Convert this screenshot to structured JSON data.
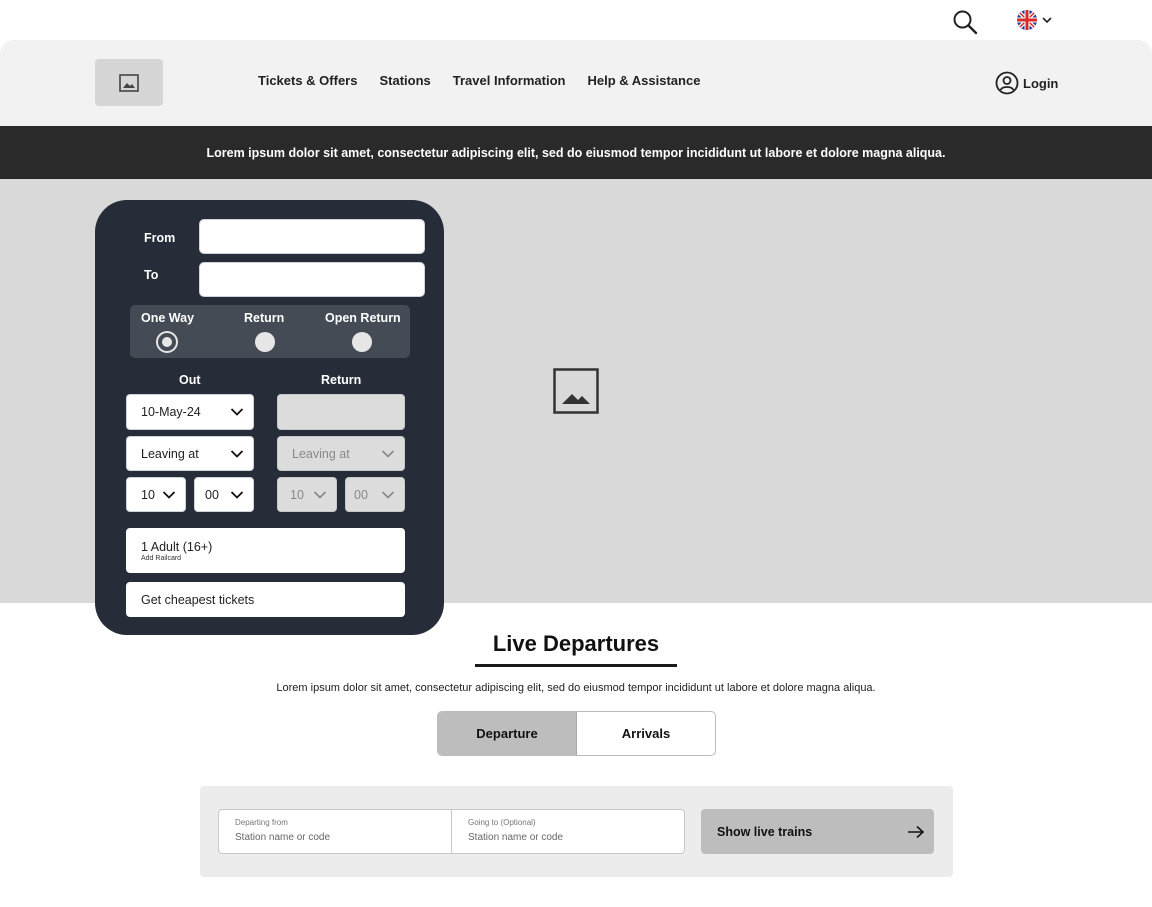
{
  "header": {
    "nav": [
      "Tickets & Offers",
      "Stations",
      "Travel Information",
      "Help & Assistance"
    ],
    "login_label": "Login",
    "icons": {
      "search": "search-icon",
      "language": "uk-flag-icon",
      "user": "user-circle-icon",
      "logo": "image-placeholder-icon"
    }
  },
  "banner": {
    "text": "Lorem ipsum dolor sit amet, consectetur adipiscing elit, sed do eiusmod tempor incididunt ut labore et dolore magna aliqua."
  },
  "booking": {
    "from_label": "From",
    "from_value": "",
    "to_label": "To",
    "to_value": "",
    "trip_types": [
      "One Way",
      "Return",
      "Open Return"
    ],
    "selected_trip": "One Way",
    "out_label": "Out",
    "return_label": "Return",
    "out_date": "10-May-24",
    "return_date": "",
    "out_leaving": "Leaving at",
    "return_leaving": "Leaving at",
    "out_hour": "10",
    "out_minute": "00",
    "return_hour": "10",
    "return_minute": "00",
    "passengers": "1 Adult (16+)",
    "railcard_link": "Add Railcard",
    "submit_label": "Get cheapest tickets"
  },
  "live_departures": {
    "title": "Live Departures",
    "description": "Lorem ipsum dolor sit amet, consectetur adipiscing elit, sed do eiusmod tempor incididunt ut labore et dolore magna aliqua.",
    "tabs": [
      "Departure",
      "Arrivals"
    ],
    "active_tab": "Departure",
    "departing_label": "Departing from",
    "departing_placeholder": "Station name or code",
    "going_label": "Going to (Optional)",
    "going_placeholder": "Station name or code",
    "show_button": "Show live trains"
  },
  "colors": {
    "panel": "#272d38",
    "banner": "#2a2a2a",
    "hero": "#d9d9d9",
    "header": "#f2f2f2"
  }
}
